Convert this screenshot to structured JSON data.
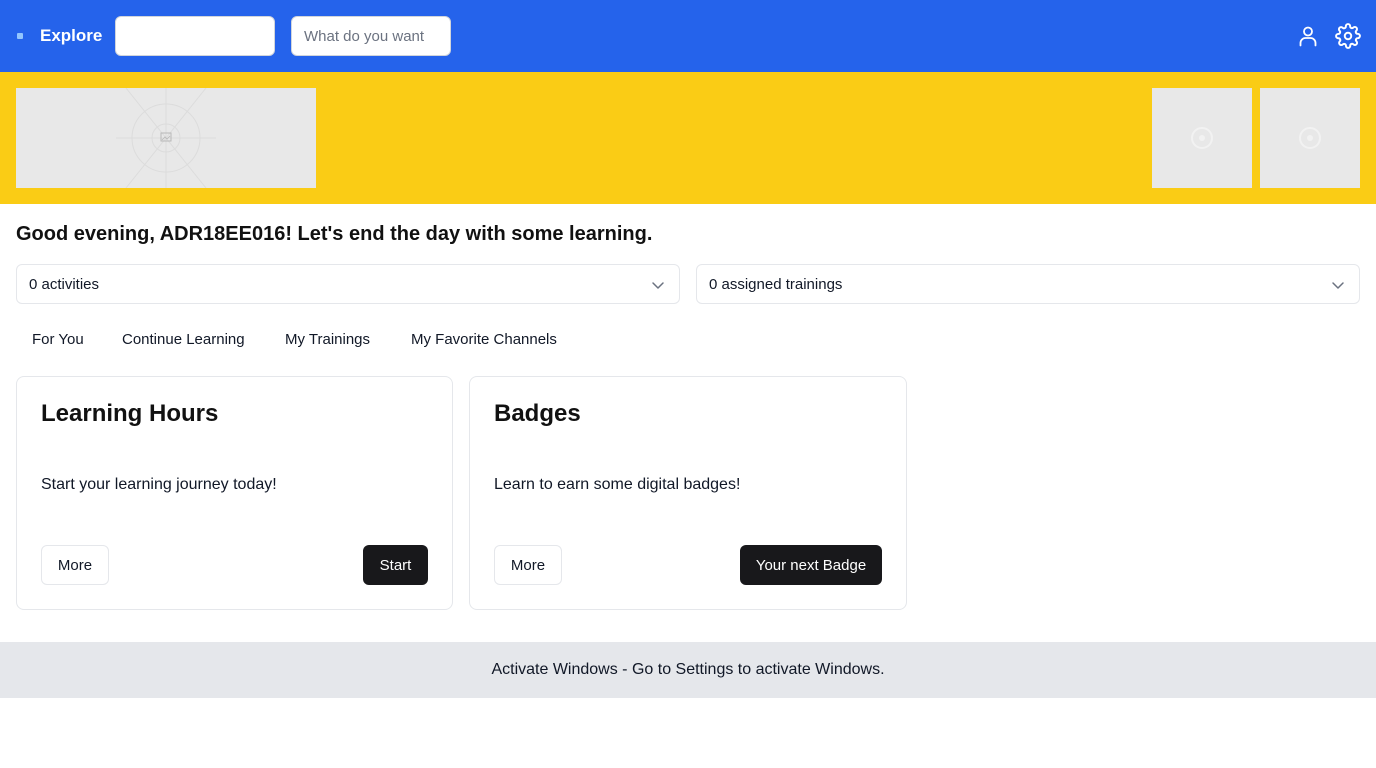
{
  "header": {
    "brand": "Explore",
    "input1": {
      "value": "",
      "placeholder": ""
    },
    "input2": {
      "value": "",
      "placeholder": "What do you want"
    },
    "icons": [
      "menu-dot-icon",
      "user-icon",
      "gear-icon"
    ],
    "background": "#2563eb"
  },
  "banner": {
    "background": "#facc15",
    "placeholders": [
      "image-placeholder",
      "image-placeholder",
      "image-placeholder"
    ]
  },
  "greeting": "Good evening, ADR18EE016! Let's end the day with some learning.",
  "dropdowns": {
    "activities": "0 activities",
    "trainings": "0 assigned trainings"
  },
  "tabs": [
    {
      "label": "For You"
    },
    {
      "label": "Continue Learning"
    },
    {
      "label": "My Trainings"
    },
    {
      "label": "My Favorite Channels"
    }
  ],
  "cards": [
    {
      "title": "Learning Hours",
      "description": "Start your learning journey today!",
      "secondary_button": "More",
      "primary_button": "Start"
    },
    {
      "title": "Badges",
      "description": "Learn to earn some digital badges!",
      "secondary_button": "More",
      "primary_button": "Your next Badge"
    }
  ],
  "activation_notice": "Activate Windows - Go to Settings to activate Windows."
}
